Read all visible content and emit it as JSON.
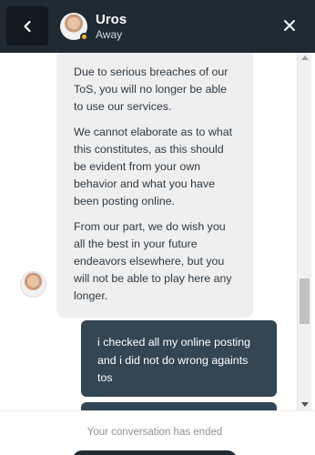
{
  "header": {
    "back_icon": "chevron-left-icon",
    "agent_name": "Uros",
    "agent_status": "Away",
    "status_color": "#f2b233",
    "close_icon": "close-icon",
    "background": "#1f2a33"
  },
  "messages": {
    "incoming": {
      "paragraphs": [
        "Due to serious breaches of our ToS, you will no longer be able to use our services.",
        "We cannot elaborate as to what this constitutes, as this should be evident from your own behavior and what you have been posting online.",
        "From our part, we do wish you all the best in your future endeavors elsewhere, but you will not be able to play here any longer."
      ]
    },
    "outgoing": [
      {
        "text": "i checked all my online posting and i did not do wrong againts tos"
      }
    ]
  },
  "footer": {
    "ended_text": "Your conversation has ended"
  },
  "colors": {
    "incoming_bubble": "#efefef",
    "outgoing_bubble": "#344553"
  }
}
